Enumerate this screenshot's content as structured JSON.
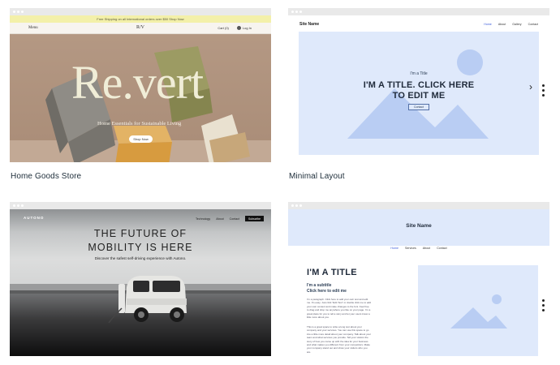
{
  "cards": [
    {
      "caption": "Home Goods Store",
      "announcement": "Free Shipping on all International orders over $50 Shop Now",
      "menu": "Menu",
      "brand": "R/V",
      "cart": "Cart (0)",
      "login": "Log In",
      "headline": "Re.vert",
      "tagline": "Home Essentials for Sustainable Living",
      "shop_button": "Shop Now"
    },
    {
      "caption": "Minimal Layout",
      "site_name": "Site Name",
      "nav": [
        "Home",
        "About",
        "Gallery",
        "Contact"
      ],
      "pretitle": "I'm a Title",
      "title_line1": "I'M A TITLE. CLICK HERE",
      "title_line2": "TO EDIT ME",
      "button": "Contact"
    },
    {
      "caption": "",
      "logo": "AUTONO",
      "nav": [
        "Technology",
        "About",
        "Contact"
      ],
      "cta": "Subscribe",
      "headline_line1": "THE FUTURE OF",
      "headline_line2": "MOBILITY IS HERE",
      "subline": "Discover the safest self-driving experience with Autono."
    },
    {
      "caption": "",
      "site_name": "Site Name",
      "nav": [
        "Home",
        "Services",
        "About",
        "Contact"
      ],
      "title": "I'M A TITLE",
      "subtitle_line1": "I'm a subtitle",
      "subtitle_line2": "Click here to edit me",
      "paragraph1": "I'm a paragraph. Click here to add your own text and edit me. It's easy. Just click \"Edit Text\" or double click me to add your own content and make changes to the font. Feel free to drag and drop me anywhere you like on your page. I'm a great place for you to tell a story and let your users know a little more about you.",
      "paragraph2": "This is a great space to write a long text about your company and your services. You can use this space to go into a little more detail about your company. Talk about your team and what services you provide. Tell your visitors the story of how you came up with the idea for your business and what makes you different from your competitors. Make your company stand out and show your visitors who you are."
    }
  ],
  "colors": {
    "page_bg": "#ffffff",
    "chrome": "#e9e9e9",
    "placeholder_blue": "#dfe9fb",
    "shape_blue": "#b9cdf3",
    "link_blue": "#3b5bdb",
    "caption_text": "#20303c"
  }
}
